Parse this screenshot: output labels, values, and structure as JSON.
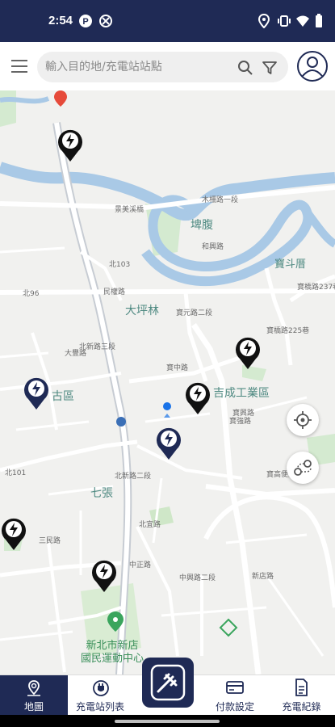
{
  "status_bar": {
    "time": "2:54",
    "left_icons": [
      "p-badge-icon",
      "blocked-icon"
    ],
    "right_icons": [
      "location-icon",
      "vibrate-icon",
      "wifi-icon",
      "battery-icon"
    ]
  },
  "search": {
    "placeholder": "輸入目的地/充電站站點"
  },
  "map": {
    "district_labels": [
      "埤腹",
      "寶斗厝",
      "大坪林",
      "吉成工業區",
      "七張",
      "古區"
    ],
    "road_labels": [
      "木柵路一段",
      "景美溪橋",
      "和興路",
      "北103",
      "民權路",
      "北96",
      "寶元路二段",
      "寶中路",
      "寶橋路225巷",
      "寶橋路237巷",
      "寶強路",
      "寶高便道",
      "中正路",
      "北新路三段",
      "北新路二段",
      "北宜路",
      "北101",
      "新店路",
      "寶興路",
      "大豐路",
      "三民路",
      "中興路二段"
    ],
    "poi_label": "新北市新店\n國民運動中心",
    "marker_icon": "charging-bolt-icon"
  },
  "tabs": [
    {
      "label": "地圖",
      "icon": "map-pin-icon",
      "active": true
    },
    {
      "label": "充電站列表",
      "icon": "station-list-icon",
      "active": false
    },
    {
      "label": "付款設定",
      "icon": "credit-card-icon",
      "active": false
    },
    {
      "label": "充電紀錄",
      "icon": "document-icon",
      "active": false
    }
  ],
  "colors": {
    "primary": "#1f2a55",
    "river": "#a9c9e6",
    "park": "#c9e7c0",
    "marker_black": "#111111",
    "marker_navy": "#1f2a55"
  }
}
